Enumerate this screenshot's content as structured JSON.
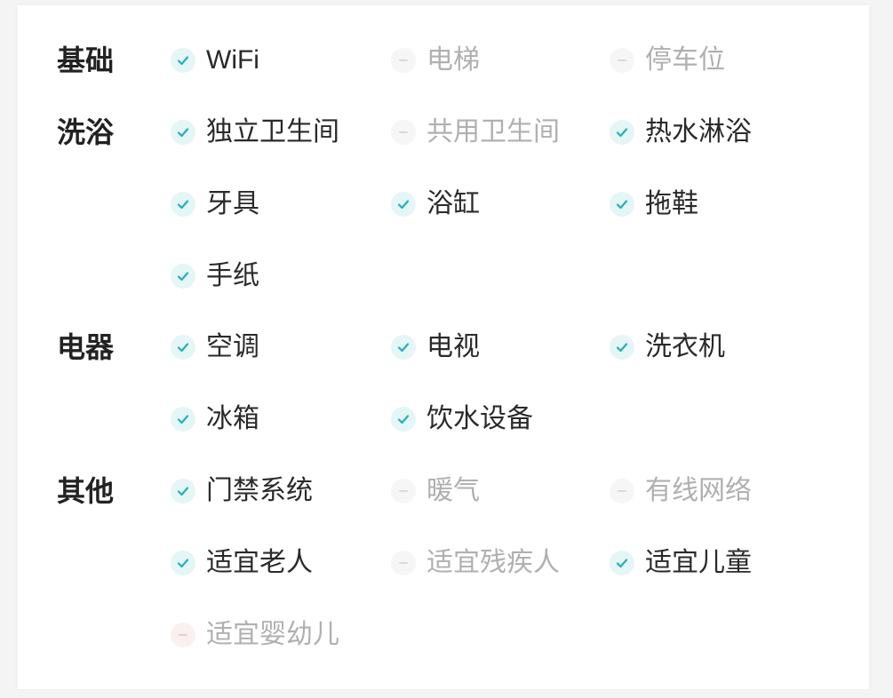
{
  "check_color": "#1fb2b8",
  "sections": [
    {
      "label": "基础",
      "items": [
        {
          "label": "WiFi",
          "available": true
        },
        {
          "label": "电梯",
          "available": false
        },
        {
          "label": "停车位",
          "available": false
        }
      ]
    },
    {
      "label": "洗浴",
      "items": [
        {
          "label": "独立卫生间",
          "available": true
        },
        {
          "label": "共用卫生间",
          "available": false
        },
        {
          "label": "热水淋浴",
          "available": true
        },
        {
          "label": "牙具",
          "available": true
        },
        {
          "label": "浴缸",
          "available": true
        },
        {
          "label": "拖鞋",
          "available": true
        },
        {
          "label": "手纸",
          "available": true
        }
      ]
    },
    {
      "label": "电器",
      "items": [
        {
          "label": "空调",
          "available": true
        },
        {
          "label": "电视",
          "available": true
        },
        {
          "label": "洗衣机",
          "available": true
        },
        {
          "label": "冰箱",
          "available": true
        },
        {
          "label": "饮水设备",
          "available": true
        }
      ]
    },
    {
      "label": "其他",
      "items": [
        {
          "label": "门禁系统",
          "available": true
        },
        {
          "label": "暖气",
          "available": false
        },
        {
          "label": "有线网络",
          "available": false
        },
        {
          "label": "适宜老人",
          "available": true
        },
        {
          "label": "适宜残疾人",
          "available": false
        },
        {
          "label": "适宜儿童",
          "available": true
        },
        {
          "label": "适宜婴幼儿",
          "available": false,
          "badge": "red-dash"
        }
      ]
    }
  ]
}
